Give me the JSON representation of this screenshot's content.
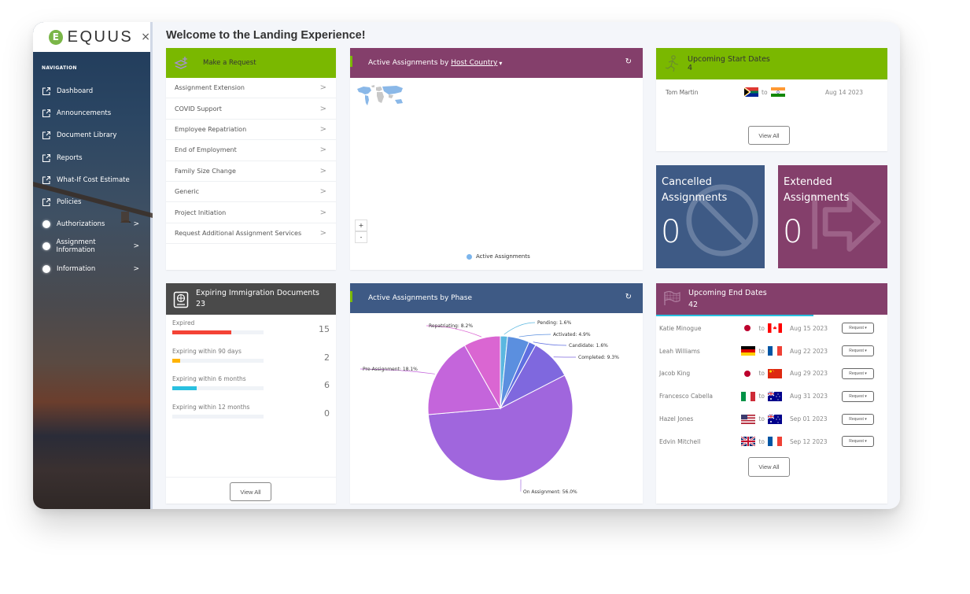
{
  "app": {
    "logo_text": "EQUUS",
    "logo_mark": "E",
    "close_label": "×"
  },
  "sidebar": {
    "nav_title": "NAVIGATION",
    "items": [
      {
        "label": "Dashboard",
        "icon": "external-link-icon"
      },
      {
        "label": "Announcements",
        "icon": "external-link-icon"
      },
      {
        "label": "Document Library",
        "icon": "external-link-icon"
      },
      {
        "label": "Reports",
        "icon": "external-link-icon"
      },
      {
        "label": "What-If Cost Estimate",
        "icon": "external-link-icon"
      },
      {
        "label": "Policies",
        "icon": "external-link-icon"
      },
      {
        "label": "Authorizations",
        "icon": "circle-icon",
        "chevron": ">"
      },
      {
        "label": "Assignment Information",
        "icon": "circle-icon",
        "chevron": ">"
      },
      {
        "label": "Information",
        "icon": "circle-icon",
        "chevron": ">"
      }
    ]
  },
  "page": {
    "title": "Welcome to the Landing Experience!"
  },
  "request_card": {
    "title": "Make a Request",
    "icon": "stack-plus-icon",
    "items": [
      "Assignment Extension",
      "COVID Support",
      "Employee Repatriation",
      "End of Employment",
      "Family Size Change",
      "Generic",
      "Project Initiation",
      "Request Additional Assignment Services"
    ],
    "chevron": ">"
  },
  "map_card": {
    "title_prefix": "Active Assignments by",
    "title_link": "Host Country",
    "dropdown_caret": "▾",
    "refresh_icon": "↻",
    "zoom_in": "+",
    "zoom_out": "-",
    "legend_label": "Active Assignments",
    "legend_color": "#7cb5ec"
  },
  "start_card": {
    "title": "Upcoming Start Dates",
    "count": "4",
    "rows": [
      {
        "name": "Tom Martin",
        "from_flag": "ZA",
        "to_word": "to",
        "to_flag": "IN",
        "date": "Aug 14 2023"
      }
    ],
    "view_all": "View All"
  },
  "tiles": {
    "cancelled": {
      "line1": "Cancelled",
      "line2": "Assignments",
      "value": "0",
      "icon": "ban-icon",
      "color": "#3e5a85"
    },
    "extended": {
      "line1": "Extended",
      "line2": "Assignments",
      "value": "0",
      "icon": "arrow-right-icon",
      "color": "#843f6b"
    }
  },
  "expiring_card": {
    "title": "Expiring Immigration Documents",
    "count": "23",
    "icon": "passport-icon",
    "rows": [
      {
        "label": "Expired",
        "value": "15",
        "fraction": 0.65,
        "color": "#f44336"
      },
      {
        "label": "Expiring within 90 days",
        "value": "2",
        "fraction": 0.09,
        "color": "#ffb300"
      },
      {
        "label": "Expiring within 6 months",
        "value": "6",
        "fraction": 0.27,
        "color": "#29c0e0"
      },
      {
        "label": "Expiring within 12 months",
        "value": "0",
        "fraction": 0,
        "color": "#cccccc"
      }
    ],
    "view_all": "View All"
  },
  "phase_card": {
    "title": "Active Assignments by Phase",
    "refresh_icon": "↻"
  },
  "end_card": {
    "title": "Upcoming End Dates",
    "count": "42",
    "icon": "checkered-flag-icon",
    "rows": [
      {
        "name": "Katie Minogue",
        "from_flag": "JP",
        "to_word": "to",
        "to_flag": "CA",
        "date": "Aug 15 2023",
        "action": "Request ▾"
      },
      {
        "name": "Leah Williams",
        "from_flag": "DE",
        "to_word": "to",
        "to_flag": "FR",
        "date": "Aug 22 2023",
        "action": "Request ▾"
      },
      {
        "name": "Jacob King",
        "from_flag": "JP",
        "to_word": "to",
        "to_flag": "CN",
        "date": "Aug 29 2023",
        "action": "Request ▾"
      },
      {
        "name": "Francesco Cabella",
        "from_flag": "IT",
        "to_word": "to",
        "to_flag": "AU",
        "date": "Aug 31 2023",
        "action": "Request ▾"
      },
      {
        "name": "Hazel Jones",
        "from_flag": "US",
        "to_word": "to",
        "to_flag": "AU",
        "date": "Sep 01 2023",
        "action": "Request ▾"
      },
      {
        "name": "Edvin Mitchell",
        "from_flag": "GB",
        "to_word": "to",
        "to_flag": "FR",
        "date": "Sep 12 2023",
        "action": "Request ▾"
      }
    ],
    "view_all": "View All"
  },
  "chart_data": {
    "type": "pie",
    "title": "Active Assignments by Phase",
    "slices": [
      {
        "label": "Pending",
        "value": 1.6,
        "color": "#5bb7e0"
      },
      {
        "label": "Activated",
        "value": 4.9,
        "color": "#5b8fdf"
      },
      {
        "label": "Candidate",
        "value": 1.6,
        "color": "#5f6fe0"
      },
      {
        "label": "Completed",
        "value": 9.3,
        "color": "#7f68de"
      },
      {
        "label": "On Assignment",
        "value": 56.0,
        "color": "#a066dd"
      },
      {
        "label": "Pre-Assignment",
        "value": 18.1,
        "color": "#c465db"
      },
      {
        "label": "Repatriating",
        "value": 8.2,
        "color": "#da66d2"
      }
    ],
    "label_format": "{label}: {value}%"
  }
}
